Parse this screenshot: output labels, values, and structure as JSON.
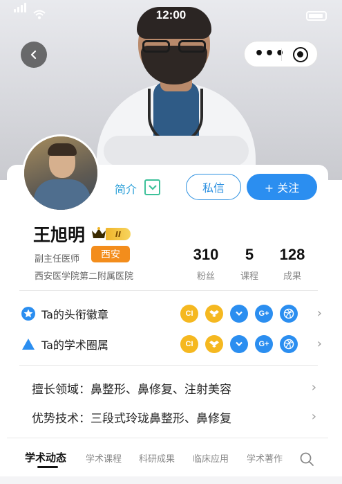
{
  "status_bar": {
    "time": "12:00"
  },
  "profile": {
    "intro_label": "简介",
    "message_button": "私信",
    "follow_button": "+ 关注",
    "name": "王旭明",
    "vip_level": "II",
    "title": "副主任医师",
    "city": "西安",
    "hospital": "西安医学院第二附属医院"
  },
  "stats": [
    {
      "value": "310",
      "label": "粉丝"
    },
    {
      "value": "5",
      "label": "课程"
    },
    {
      "value": "128",
      "label": "成果"
    }
  ],
  "rows": {
    "badges_title": "Ta的头衔徽章",
    "circles_title": "Ta的学术圈属"
  },
  "badge_icons": [
    {
      "name": "ci-badge-icon",
      "text": "CI",
      "color": "#f5b820"
    },
    {
      "name": "dropbox-badge-icon",
      "text": "",
      "color": "#f5b820"
    },
    {
      "name": "chevron-badge-icon",
      "text": "",
      "color": "#2b8ef0"
    },
    {
      "name": "google-plus-badge-icon",
      "text": "G+",
      "color": "#2b8ef0"
    },
    {
      "name": "dribbble-badge-icon",
      "text": "",
      "color": "#2b8ef0"
    }
  ],
  "expertise": {
    "specialty": "擅长领域：鼻整形、鼻修复、注射美容",
    "technique": "优势技术：三段式玲珑鼻整形、鼻修复"
  },
  "tabs": [
    {
      "label": "学术动态",
      "active": true
    },
    {
      "label": "学术课程",
      "active": false
    },
    {
      "label": "科研成果",
      "active": false
    },
    {
      "label": "临床应用",
      "active": false
    },
    {
      "label": "学术著作",
      "active": false
    }
  ],
  "colors": {
    "accent": "#2b8ef0",
    "intro": "#2a9fd8",
    "toggle": "#3dc19a",
    "city_badge": "#f38d1c",
    "badge_yellow": "#f5b820"
  }
}
